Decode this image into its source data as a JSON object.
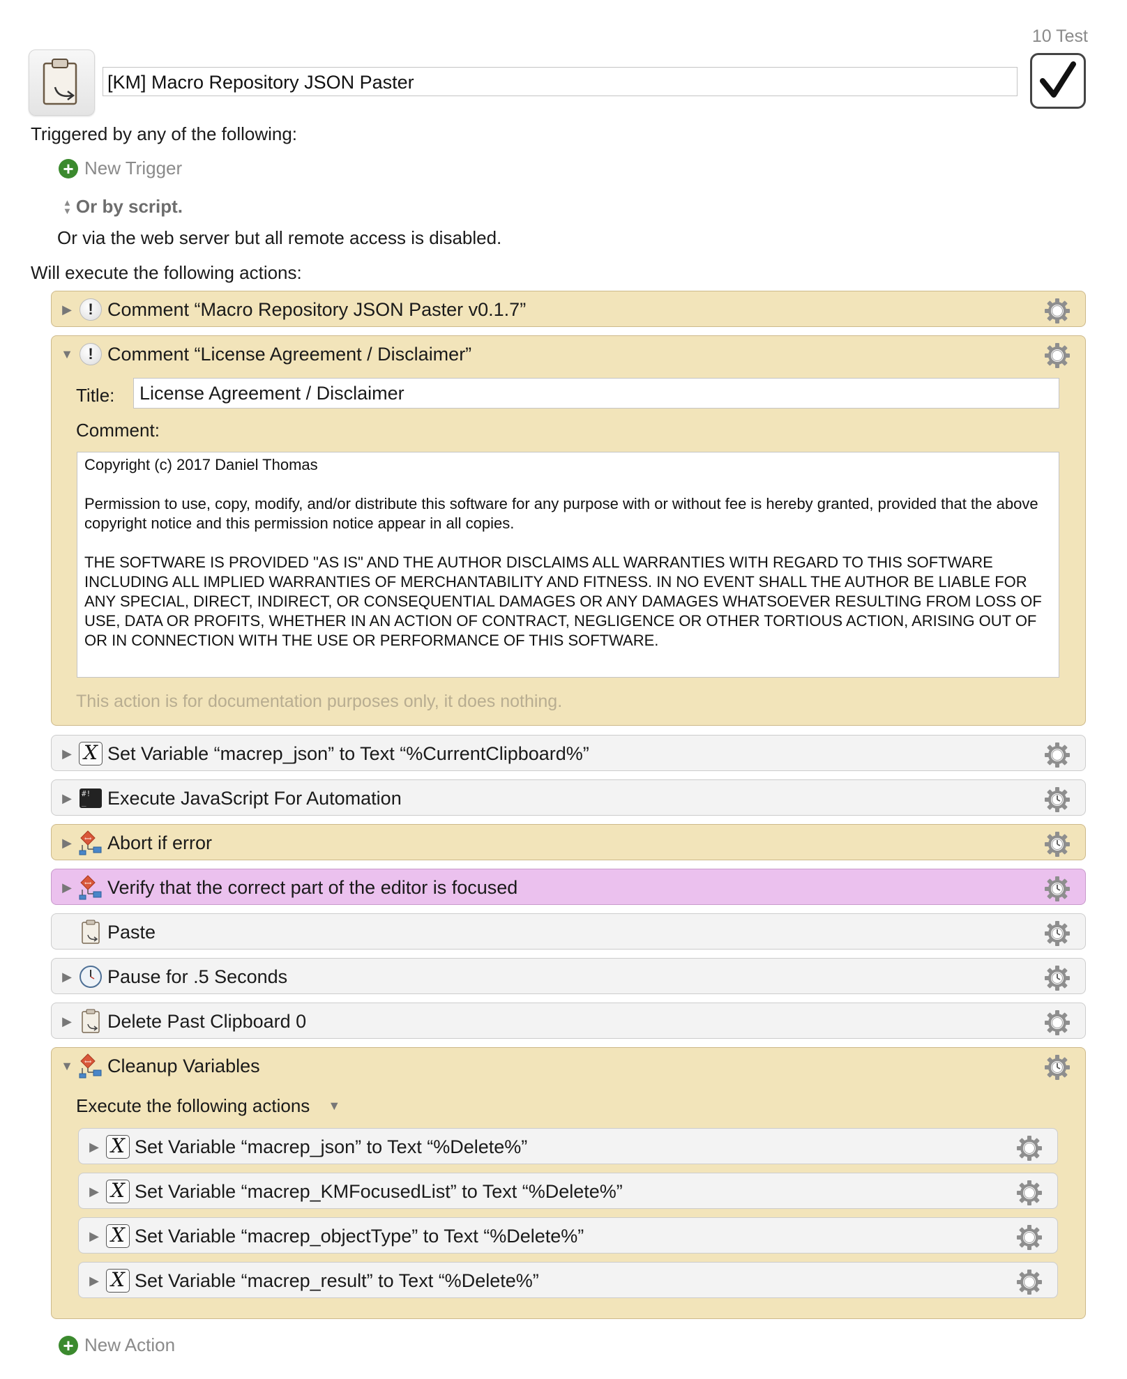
{
  "macro": {
    "group_label": "10 Test",
    "name": "[KM] Macro Repository JSON Paster",
    "enabled": true
  },
  "triggers": {
    "heading": "Triggered by any of the following:",
    "new_trigger_label": "New Trigger",
    "script_label": "Or by script.",
    "web_server_note": "Or via the web server but all remote access is disabled."
  },
  "actions_heading": "Will execute the following actions:",
  "actions": [
    {
      "title": "Comment “Macro Repository JSON Paster v0.1.7”",
      "icon": "comment-icon",
      "color": "#f2e4ba"
    },
    {
      "title": "Comment “License Agreement / Disclaimer”",
      "icon": "comment-icon",
      "color": "#f2e4ba",
      "expanded": true,
      "title_label": "Title:",
      "title_value": "License Agreement / Disclaimer",
      "comment_label": "Comment:",
      "comment_text": "Copyright (c) 2017 Daniel Thomas\n\nPermission to use, copy, modify, and/or distribute this software for any purpose with or without fee is hereby granted, provided that the above copyright notice and this permission notice appear in all copies.\n\nTHE SOFTWARE IS PROVIDED \"AS IS\" AND THE AUTHOR DISCLAIMS ALL WARRANTIES WITH REGARD TO THIS SOFTWARE INCLUDING ALL IMPLIED WARRANTIES OF MERCHANTABILITY AND FITNESS. IN NO EVENT SHALL THE AUTHOR BE LIABLE FOR ANY SPECIAL, DIRECT, INDIRECT, OR CONSEQUENTIAL DAMAGES OR ANY DAMAGES WHATSOEVER RESULTING FROM LOSS OF USE, DATA OR PROFITS, WHETHER IN AN ACTION OF CONTRACT, NEGLIGENCE OR OTHER TORTIOUS ACTION, ARISING OUT OF OR IN CONNECTION WITH THE USE OR PERFORMANCE OF THIS SOFTWARE.",
      "doc_note": "This action is for documentation purposes only, it does nothing."
    },
    {
      "title": "Set Variable “macrep_json” to Text “%CurrentClipboard%”",
      "icon": "variable-icon",
      "color": "#f3f3f3"
    },
    {
      "title": "Execute JavaScript For Automation",
      "icon": "terminal-icon",
      "color": "#f3f3f3"
    },
    {
      "title": "Abort if error",
      "icon": "flowchart-icon",
      "color": "#f2e4ba"
    },
    {
      "title": "Verify that the correct part of the editor is focused",
      "icon": "flowchart-icon",
      "color": "#ebc1ee"
    },
    {
      "title": "Paste",
      "icon": "clipboard-icon",
      "color": "#f3f3f3"
    },
    {
      "title": "Pause for .5 Seconds",
      "icon": "clock-icon",
      "color": "#f3f3f3"
    },
    {
      "title": "Delete Past Clipboard 0",
      "icon": "clipboard-icon",
      "color": "#f3f3f3"
    },
    {
      "title": "Cleanup Variables",
      "icon": "flowchart-icon",
      "color": "#f2e4ba",
      "expanded": true,
      "sub_label": "Execute the following actions",
      "children": [
        {
          "title": "Set Variable “macrep_json” to Text “%Delete%”",
          "icon": "variable-icon"
        },
        {
          "title": "Set Variable “macrep_KMFocusedList” to Text “%Delete%”",
          "icon": "variable-icon"
        },
        {
          "title": "Set Variable “macrep_objectType” to Text “%Delete%”",
          "icon": "variable-icon"
        },
        {
          "title": "Set Variable “macrep_result” to Text “%Delete%”",
          "icon": "variable-icon"
        }
      ]
    }
  ],
  "new_action_label": "New Action"
}
